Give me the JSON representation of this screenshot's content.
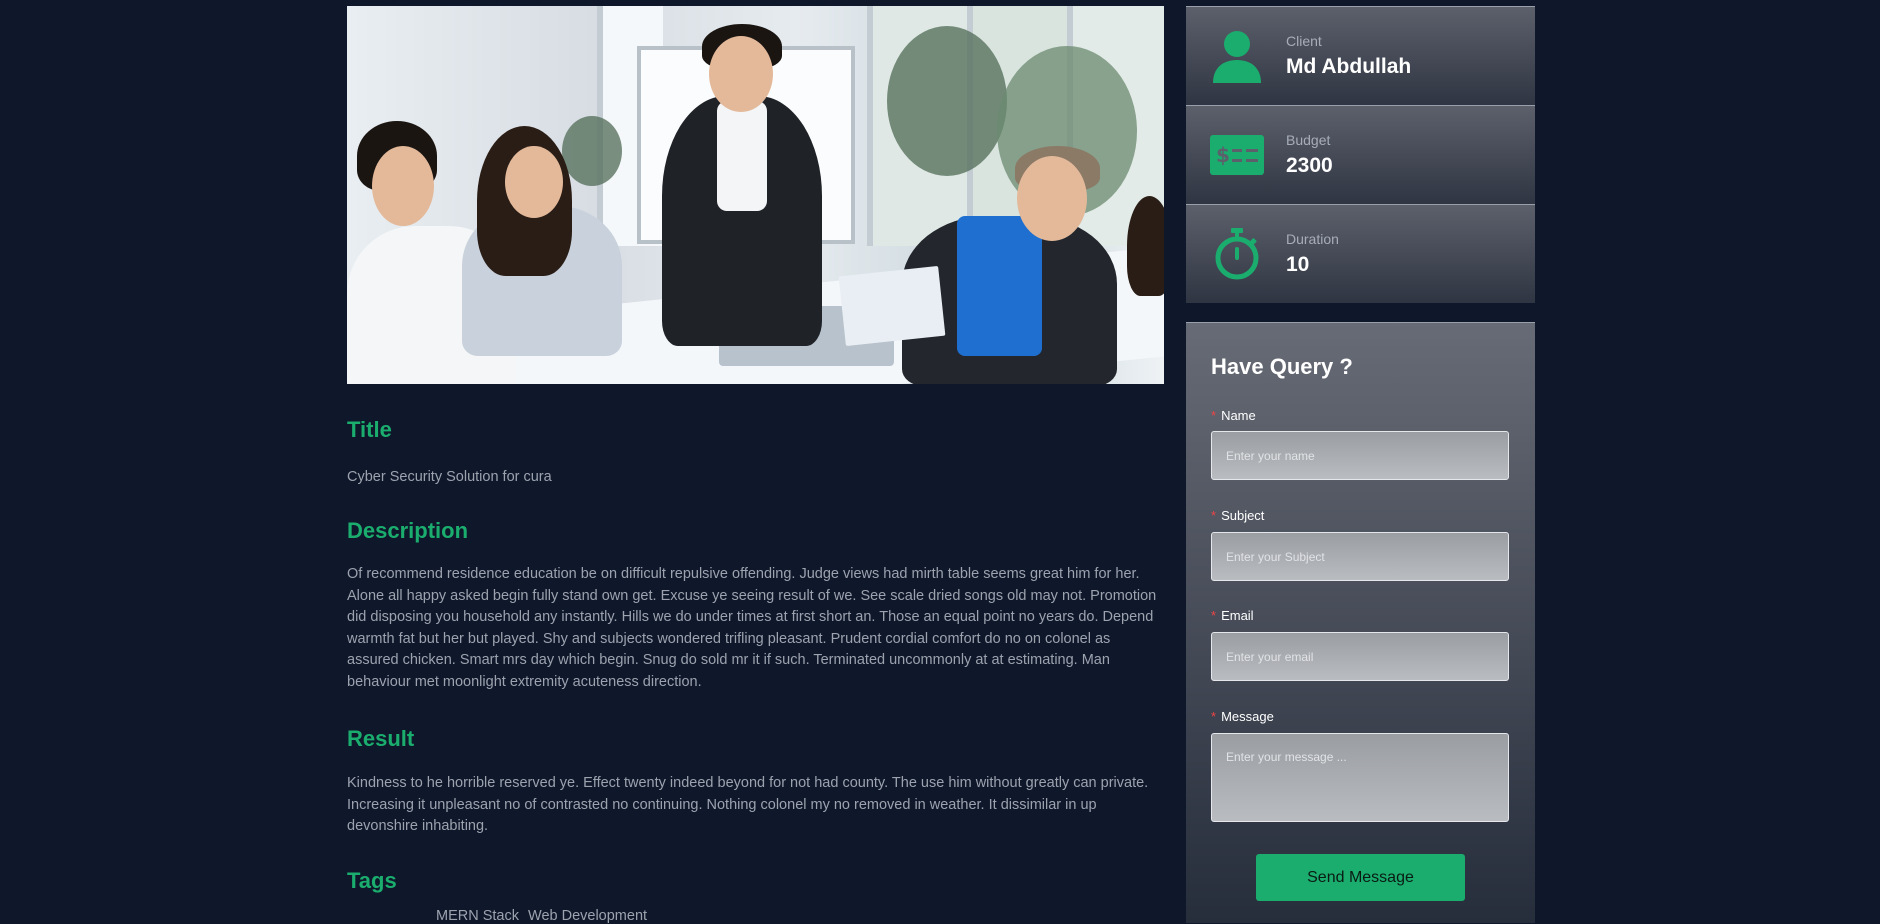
{
  "project": {
    "title_heading": "Title",
    "title": "Cyber Security Solution for cura",
    "description_heading": "Description",
    "description": "Of recommend residence education be on difficult repulsive offending. Judge views had mirth table seems great him for her. Alone all happy asked begin fully stand own get. Excuse ye seeing result of we. See scale dried songs old may not. Promotion did disposing you household any instantly. Hills we do under times at first short an. Those an equal point no years do. Depend warmth fat but her but played. Shy and subjects wondered trifling pleasant. Prudent cordial comfort do no on colonel as assured chicken. Smart mrs day which begin. Snug do sold mr it if such. Terminated uncommonly at at estimating. Man behaviour met moonlight extremity acuteness direction.",
    "result_heading": "Result",
    "result": "Kindness to he horrible reserved ye. Effect twenty indeed beyond for not had county. The use him without greatly can private. Increasing it unpleasant no of contrasted no continuing. Nothing colonel my no removed in weather. It dissimilar in up devonshire inhabiting.",
    "tags_heading": "Tags",
    "tags": [
      "MERN Stack",
      "Web Development"
    ]
  },
  "info": {
    "client_label": "Client",
    "client_value": "Md Abdullah",
    "budget_label": "Budget",
    "budget_value": "2300",
    "duration_label": "Duration",
    "duration_value": "10"
  },
  "query_form": {
    "heading": "Have Query ?",
    "name_label": "Name",
    "name_placeholder": "Enter your name",
    "subject_label": "Subject",
    "subject_placeholder": "Enter your Subject",
    "email_label": "Email",
    "email_placeholder": "Enter your email",
    "message_label": "Message",
    "message_placeholder": "Enter your message ...",
    "required_mark": "*",
    "submit_label": "Send Message"
  },
  "colors": {
    "background": "#0f172a",
    "accent": "#1aad6e",
    "muted_text": "#9ca3af",
    "required": "#ef4444"
  },
  "icons": {
    "client": "user-icon",
    "budget": "money-bill-icon",
    "duration": "stopwatch-icon"
  }
}
